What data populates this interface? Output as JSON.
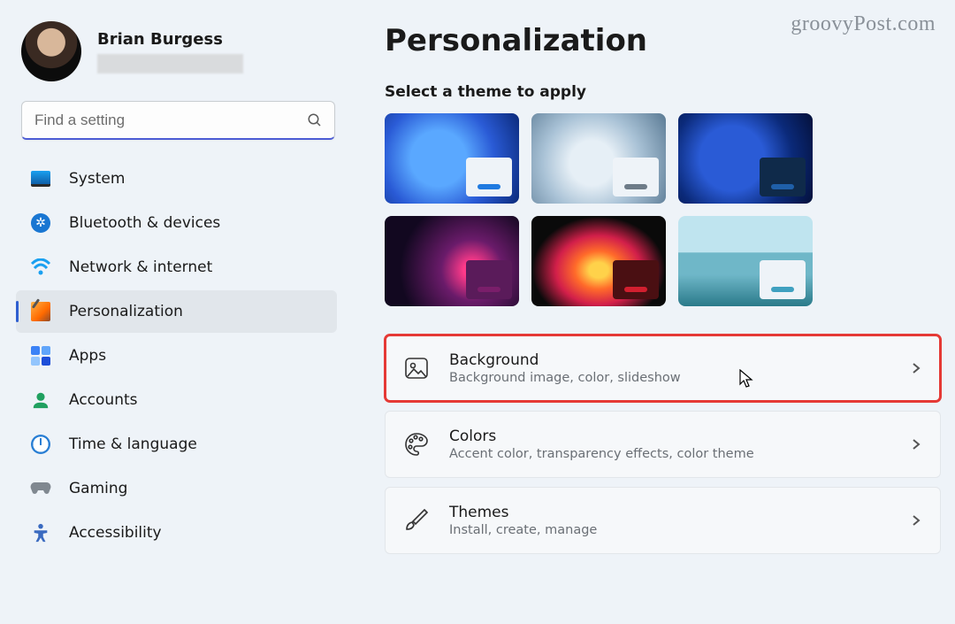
{
  "watermark": "groovyPost.com",
  "profile": {
    "name": "Brian Burgess"
  },
  "search": {
    "placeholder": "Find a setting"
  },
  "nav": {
    "items": [
      {
        "label": "System"
      },
      {
        "label": "Bluetooth & devices"
      },
      {
        "label": "Network & internet"
      },
      {
        "label": "Personalization"
      },
      {
        "label": "Apps"
      },
      {
        "label": "Accounts"
      },
      {
        "label": "Time & language"
      },
      {
        "label": "Gaming"
      },
      {
        "label": "Accessibility"
      }
    ]
  },
  "page": {
    "title": "Personalization",
    "theme_heading": "Select a theme to apply"
  },
  "settings": {
    "background": {
      "title": "Background",
      "desc": "Background image, color, slideshow"
    },
    "colors": {
      "title": "Colors",
      "desc": "Accent color, transparency effects, color theme"
    },
    "themes": {
      "title": "Themes",
      "desc": "Install, create, manage"
    }
  }
}
